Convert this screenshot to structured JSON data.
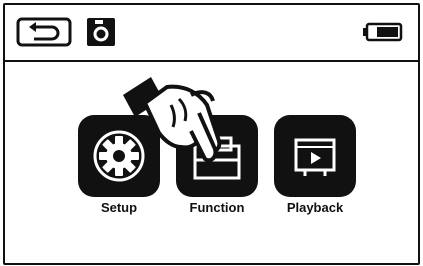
{
  "apps": [
    {
      "label": "Setup"
    },
    {
      "label": "Function"
    },
    {
      "label": "Playback"
    }
  ],
  "status": {
    "back_icon": "back-arrow-icon",
    "camera_icon": "camera-icon",
    "battery_icon": "battery-icon",
    "battery_level": 0.75
  },
  "overlay": {
    "icon": "pointing-hand-icon"
  }
}
